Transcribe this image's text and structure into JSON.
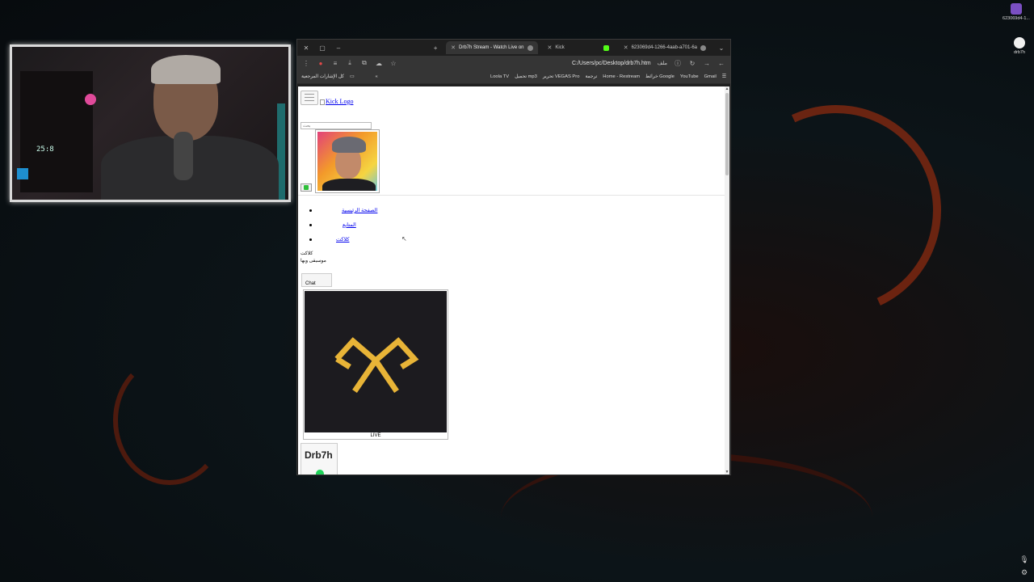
{
  "browser": {
    "tabs": [
      {
        "title": "Drb7h Stream - Watch Live on",
        "active": true
      },
      {
        "title": "Kick",
        "active": false
      },
      {
        "title": "623069d4-1266-4aab-a701-6a",
        "active": false
      }
    ],
    "address": "C:/Users/pc/Desktop/drb7h.htm",
    "file_label": "ملف",
    "bookmarks": [
      "كل الإشارات المرجعية",
      "Loola TV",
      "تحميل mp3",
      "تحرير VEGAS Pro",
      "ترجمة",
      "Home - Restream",
      "خرائط Google",
      "YouTube",
      "Gmail"
    ]
  },
  "page": {
    "logo_alt": "Kick Logo",
    "search_placeholder": "بحث",
    "nav": [
      "الصفحة الرئيسية",
      "المتابع",
      "كلاكت"
    ],
    "sub_title": "كلاكت",
    "sub_line": "موسيقى وبها",
    "chat_label": "Chat",
    "live_label": "LIVE",
    "streamer_name": "Drb7h"
  },
  "webcam": {
    "clock": "25:8"
  },
  "desktop": {
    "icons": [
      {
        "label": "623069d4-1..."
      },
      {
        "label": "drb7h"
      }
    ]
  },
  "colors": {
    "kick_green": "#53fc18",
    "logo_gold": "#e8b437",
    "live_dot": "#1fd35a"
  }
}
